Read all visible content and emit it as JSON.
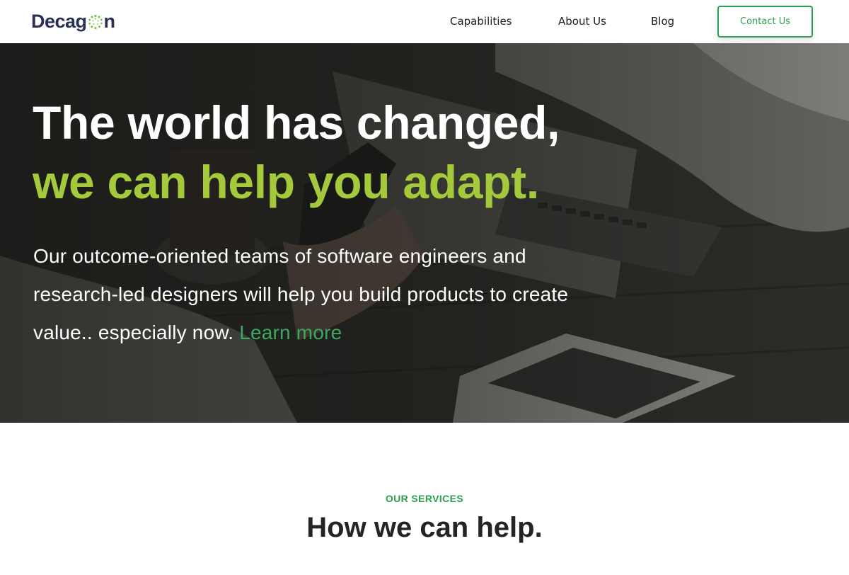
{
  "header": {
    "logo": {
      "prefix": "Decag",
      "suffix": "n"
    },
    "nav": [
      {
        "label": "Capabilities"
      },
      {
        "label": "About Us"
      },
      {
        "label": "Blog"
      }
    ],
    "contact_label": "Contact Us"
  },
  "hero": {
    "title_line1": "The world has changed,",
    "title_line2": "we can help you adapt.",
    "body": "Our outcome-oriented teams of software engineers and research-led designers will help you build products to create value.. especially now.",
    "learn_more": "Learn more",
    "colors": {
      "accent": "#a4c93a",
      "link": "#3fa860"
    }
  },
  "services": {
    "eyebrow": "OUR SERVICES",
    "title": "How we can help."
  },
  "colors": {
    "brand_navy": "#2b2e55",
    "brand_green": "#2e9e4f"
  }
}
